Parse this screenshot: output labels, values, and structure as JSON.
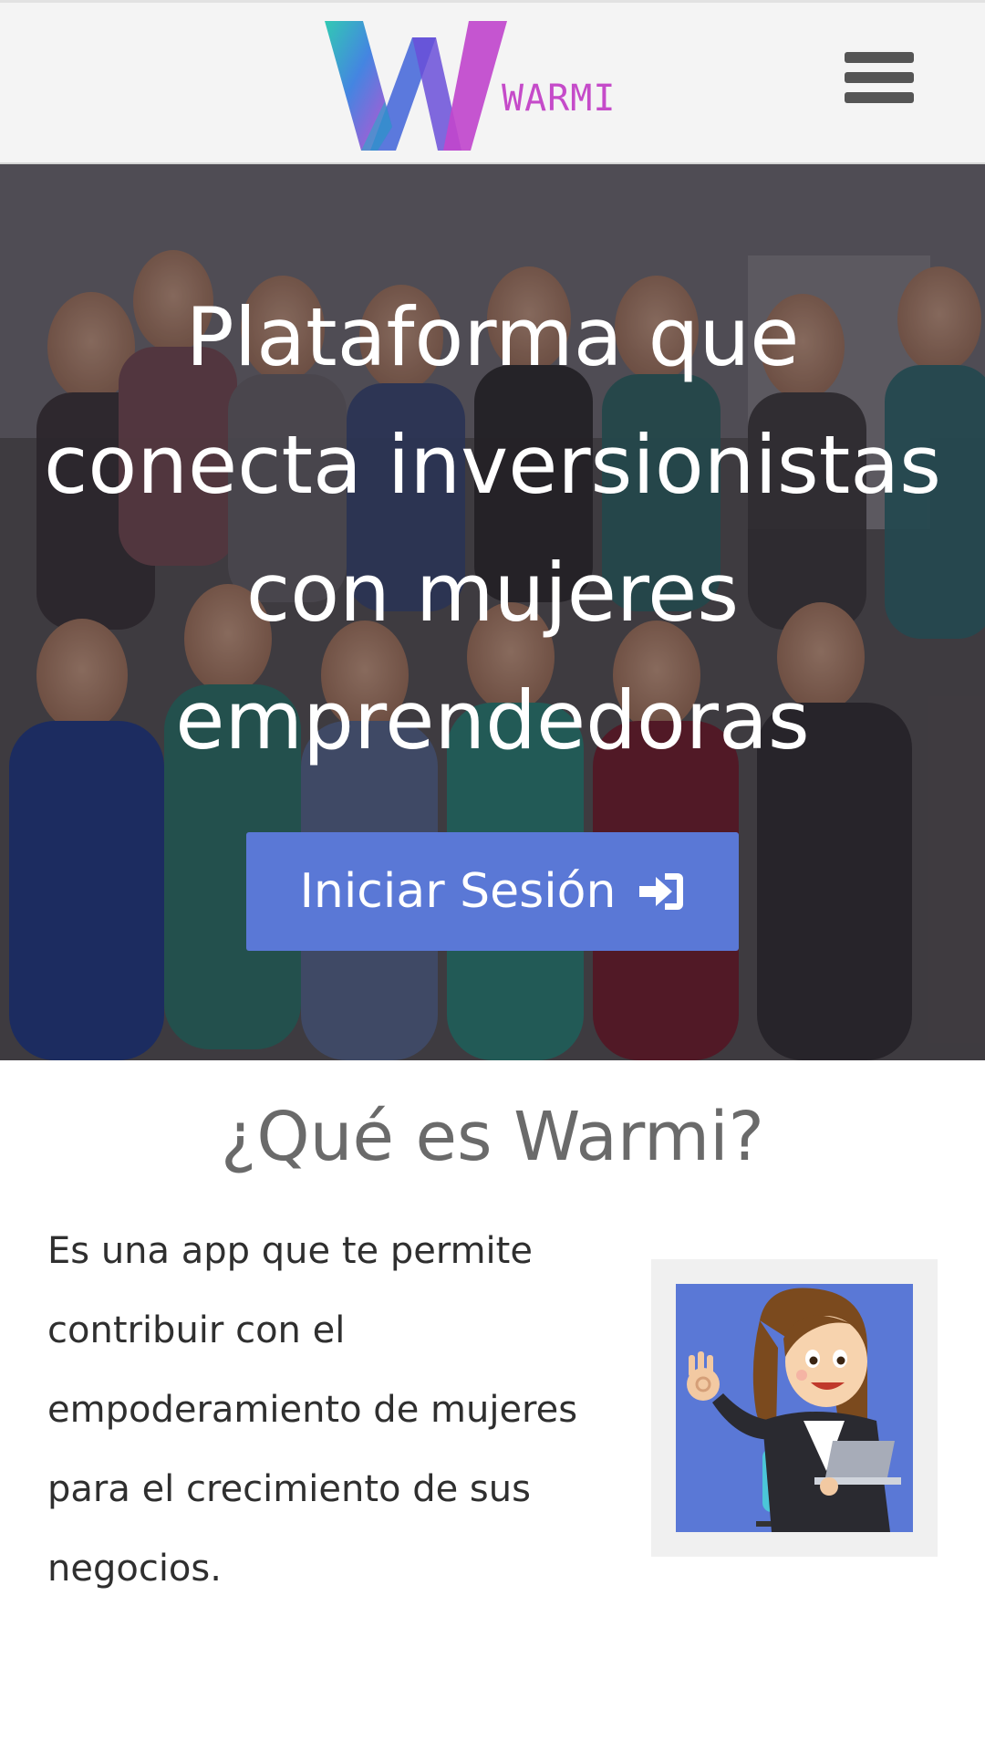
{
  "header": {
    "logo_text": "WARMI",
    "menu_icon": "hamburger-menu-icon"
  },
  "hero": {
    "title": "Plataforma que conecta inversionistas con mujeres emprendedoras",
    "login_label": "Iniciar Sesión",
    "login_icon": "sign-in-icon"
  },
  "about": {
    "title": "¿Qué es Warmi?",
    "text": "Es una app que te permite contribuir con el empoderamiento de mujeres para el crecimiento de sus negocios.",
    "illustration": "businesswoman-with-laptop-illustration"
  },
  "colors": {
    "accent": "#5a78d6",
    "logo_pink": "#c54bc9",
    "logo_teal": "#2bc6b4"
  }
}
